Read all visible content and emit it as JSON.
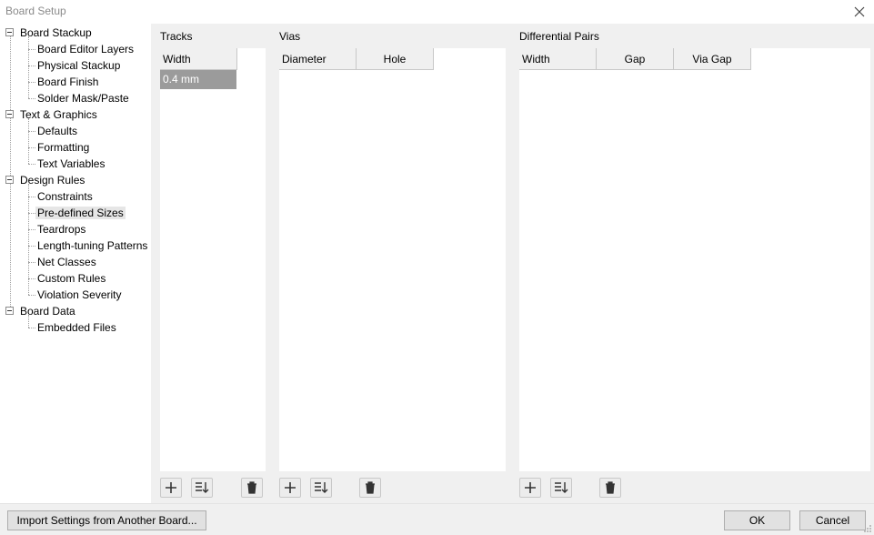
{
  "window": {
    "title": "Board Setup",
    "close_icon": "close-icon"
  },
  "tree": {
    "groups": [
      {
        "label": "Board Stackup",
        "children": [
          "Board Editor Layers",
          "Physical Stackup",
          "Board Finish",
          "Solder Mask/Paste"
        ]
      },
      {
        "label": "Text & Graphics",
        "children": [
          "Defaults",
          "Formatting",
          "Text Variables"
        ]
      },
      {
        "label": "Design Rules",
        "children": [
          "Constraints",
          "Pre-defined Sizes",
          "Teardrops",
          "Length-tuning Patterns",
          "Net Classes",
          "Custom Rules",
          "Violation Severity"
        ]
      },
      {
        "label": "Board Data",
        "children": [
          "Embedded Files"
        ]
      }
    ],
    "selected": "Pre-defined Sizes"
  },
  "tracks": {
    "title": "Tracks",
    "columns": [
      "Width"
    ],
    "rows": [
      [
        "0.4 mm"
      ]
    ]
  },
  "vias": {
    "title": "Vias",
    "columns": [
      "Diameter",
      "Hole"
    ],
    "rows": []
  },
  "diff_pairs": {
    "title": "Differential Pairs",
    "columns": [
      "Width",
      "Gap",
      "Via Gap"
    ],
    "rows": []
  },
  "footer": {
    "import_label": "Import Settings from Another Board...",
    "ok_label": "OK",
    "cancel_label": "Cancel"
  },
  "colors": {
    "selected_cell": "#9b9b9b",
    "background": "#f0f0f0"
  }
}
